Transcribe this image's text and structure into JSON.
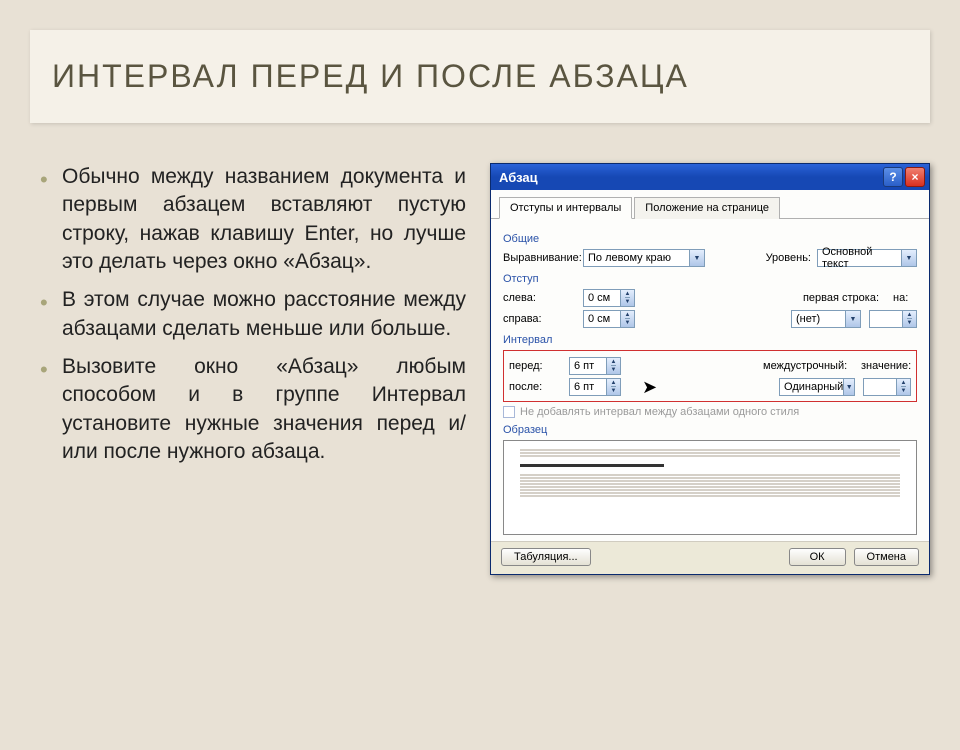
{
  "slide": {
    "title": "ИНТЕРВАЛ ПЕРЕД И ПОСЛЕ АБЗАЦА",
    "bullets": [
      "Обычно между названием документа и первым абзацем вставляют пустую строку, нажав клавишу Enter, но лучше это делать через окно «Абзац».",
      "В этом случае можно расстояние между абзацами сделать меньше или больше.",
      "Вызовите окно «Абзац» любым способом и в группе Интервал установите нужные значения перед и/или после нужного абзаца."
    ]
  },
  "dialog": {
    "title": "Абзац",
    "help": "?",
    "close": "×",
    "tabs": [
      "Отступы и интервалы",
      "Положение на странице"
    ],
    "general_label": "Общие",
    "align_label": "Выравнивание:",
    "align_value": "По левому краю",
    "level_label": "Уровень:",
    "level_value": "Основной текст",
    "indent_label": "Отступ",
    "left_label": "слева:",
    "left_value": "0 см",
    "right_label": "справа:",
    "right_value": "0 см",
    "firstline_label": "первая строка:",
    "firstline_value": "(нет)",
    "by_label": "на:",
    "by_value": "",
    "spacing_label": "Интервал",
    "before_label": "перед:",
    "before_value": "6 пт",
    "after_label": "после:",
    "after_value": "6 пт",
    "linespacing_label": "междустрочный:",
    "linespacing_value": "Одинарный",
    "lineval_label": "значение:",
    "lineval_value": "",
    "noadd_label": "Не добавлять интервал между абзацами одного стиля",
    "preview_label": "Образец",
    "tabstops": "Табуляция...",
    "ok": "ОК",
    "cancel": "Отмена"
  }
}
